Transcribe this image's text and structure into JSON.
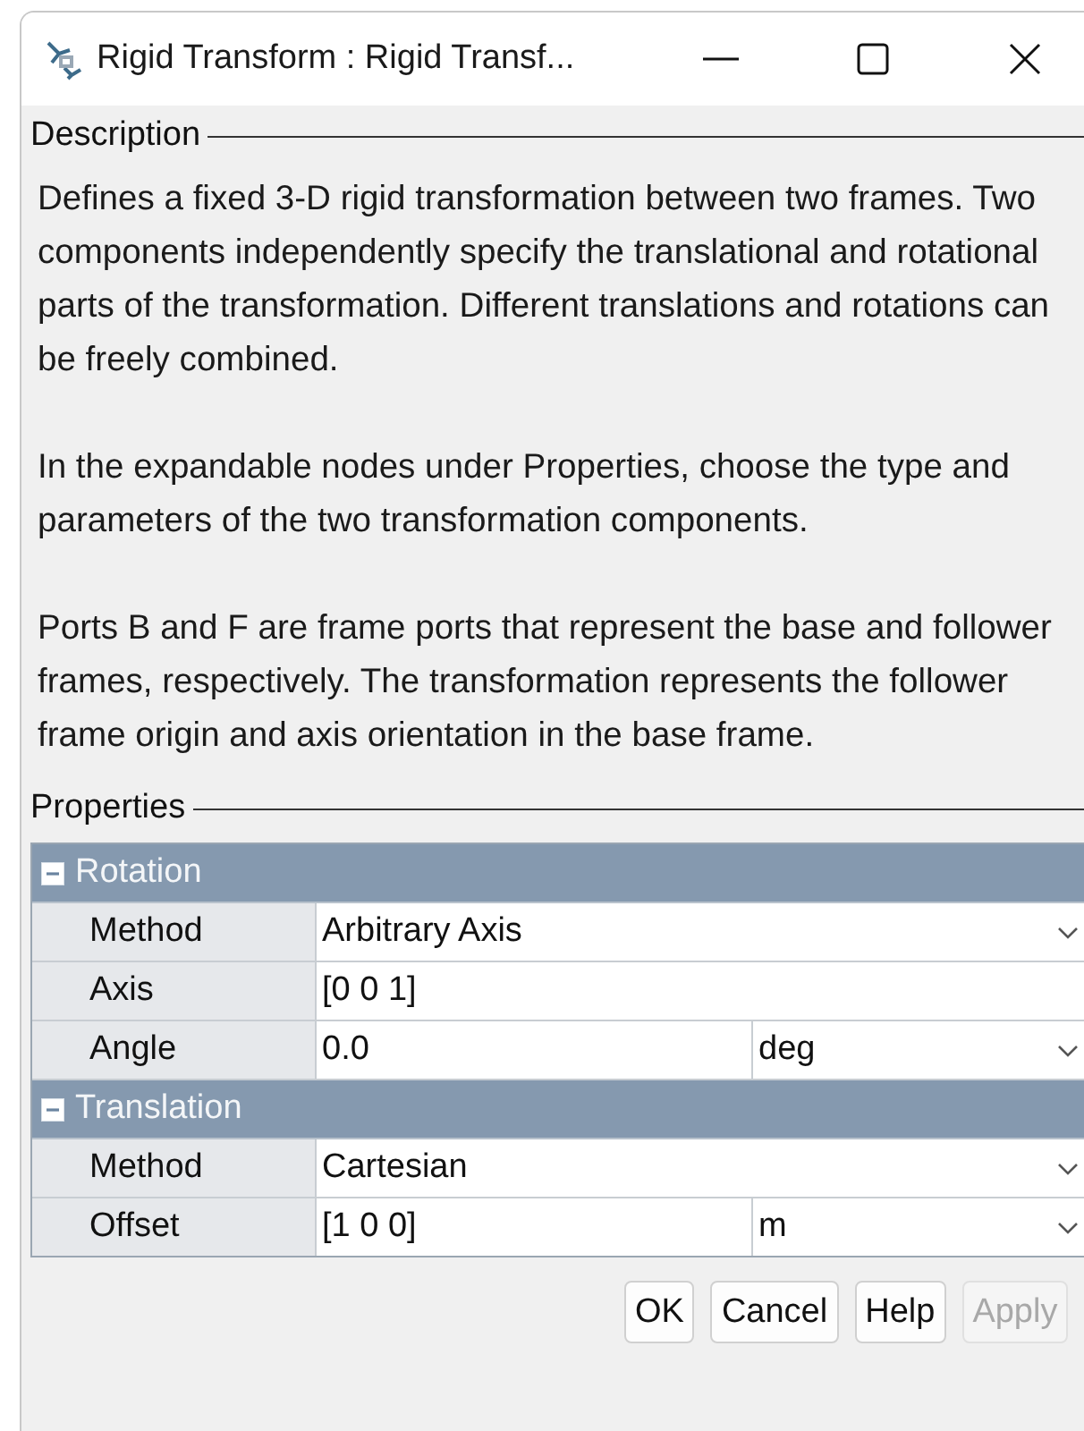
{
  "window": {
    "title": "Rigid Transform : Rigid Transf..."
  },
  "description": {
    "label": "Description",
    "paragraphs": [
      "Defines a fixed 3-D rigid transformation between two frames. Two components independently specify the translational and rotational parts of the transformation. Different translations and rotations can be freely combined.",
      "In the expandable nodes under Properties, choose the type and parameters of the two transformation components.",
      "Ports B and F are frame ports that represent the base and follower frames, respectively. The transformation represents the follower frame origin and axis orientation in the base frame."
    ]
  },
  "properties": {
    "label": "Properties",
    "groups": [
      {
        "name": "Rotation",
        "expanded": true,
        "rows": [
          {
            "label": "Method",
            "value": "Arbitrary Axis",
            "dropdown": true
          },
          {
            "label": "Axis",
            "value": "[0 0 1]",
            "dropdown": false
          },
          {
            "label": "Angle",
            "value": "0.0",
            "dropdown": false,
            "unit": "deg"
          }
        ]
      },
      {
        "name": "Translation",
        "expanded": true,
        "rows": [
          {
            "label": "Method",
            "value": "Cartesian",
            "dropdown": true
          },
          {
            "label": "Offset",
            "value": "[1 0 0]",
            "dropdown": false,
            "unit": "m"
          }
        ]
      }
    ]
  },
  "buttons": [
    {
      "label": "OK",
      "disabled": false
    },
    {
      "label": "Cancel",
      "disabled": false
    },
    {
      "label": "Help",
      "disabled": false
    },
    {
      "label": "Apply",
      "disabled": true
    }
  ]
}
